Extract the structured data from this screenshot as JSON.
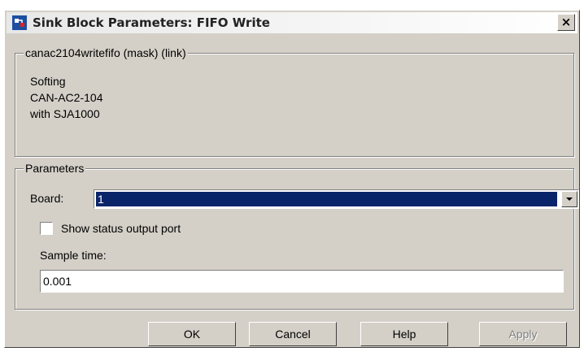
{
  "window": {
    "title": "Sink Block Parameters: FIFO Write",
    "close_label": "×"
  },
  "mask": {
    "legend": "canac2104writefifo (mask) (link)",
    "description": [
      "Softing",
      "CAN-AC2-104",
      "with SJA1000"
    ]
  },
  "parameters": {
    "legend": "Parameters",
    "board_label": "Board:",
    "board_value": "1",
    "status_port_label": "Show status output port",
    "status_port_checked": false,
    "sample_time_label": "Sample time:",
    "sample_time_value": "0.001"
  },
  "buttons": {
    "ok": "OK",
    "cancel": "Cancel",
    "help": "Help",
    "apply": "Apply"
  },
  "icons": {
    "app": "simulink-block-icon",
    "close": "close-icon",
    "dropdown": "chevron-down-icon"
  }
}
